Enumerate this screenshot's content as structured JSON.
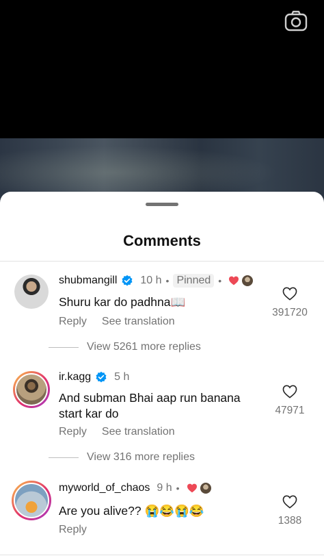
{
  "sheet": {
    "title": "Comments"
  },
  "comments": [
    {
      "username": "shubmangill",
      "verified": true,
      "time": "10 h",
      "pinned_label": "Pinned",
      "text": "Shuru kar do padhna📖",
      "reply_label": "Reply",
      "translate_label": "See translation",
      "like_count": "391720",
      "view_replies": "View 5261 more replies"
    },
    {
      "username": "ir.kagg",
      "verified": true,
      "time": "5 h",
      "text_line1": "And subman Bhai aap run banana",
      "text_line2": "start kar do",
      "reply_label": "Reply",
      "translate_label": "See translation",
      "like_count": "47971",
      "view_replies": "View 316 more replies"
    },
    {
      "username": "myworld_of_chaos",
      "time": "9 h",
      "text": "Are you alive?? 😭😂😭😂",
      "reply_label": "Reply",
      "like_count": "1388"
    }
  ],
  "icons": {
    "camera": "camera-icon",
    "verified": "verified-badge-icon",
    "like": "heart-outline-icon",
    "liked_by_creator": "heart-filled-icon"
  },
  "colors": {
    "accent_blue": "#0095f6",
    "heart_red": "#ed4956",
    "muted": "#737373"
  }
}
